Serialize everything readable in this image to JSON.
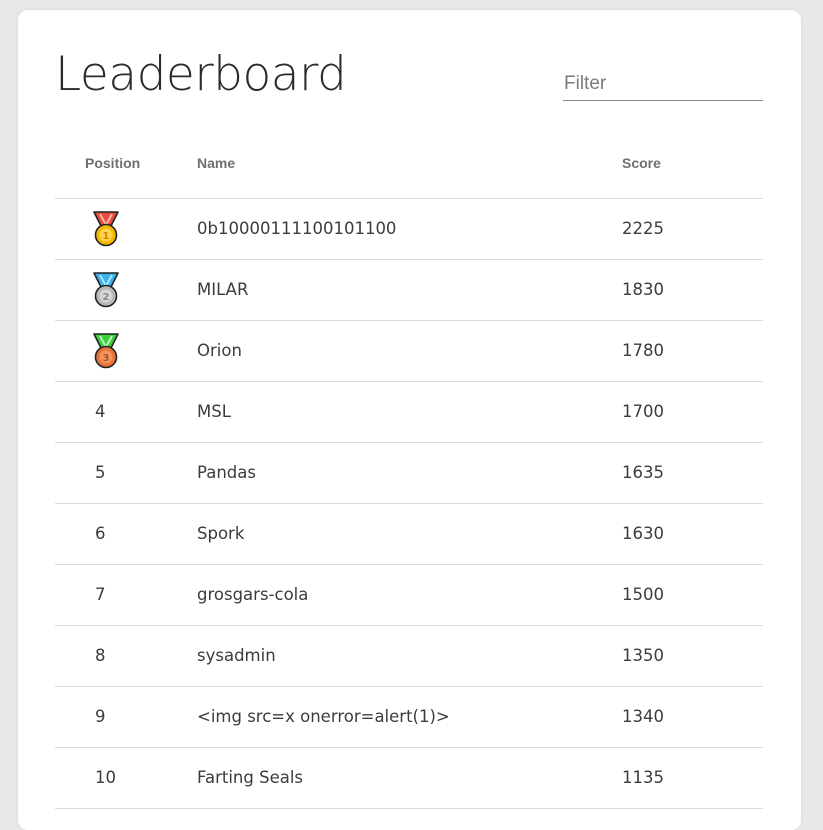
{
  "page": {
    "title": "Leaderboard",
    "filter_placeholder": "Filter"
  },
  "table": {
    "headers": {
      "position": "Position",
      "name": "Name",
      "score": "Score"
    },
    "rows": [
      {
        "position": "1",
        "medal": "gold-medal-icon",
        "name": "0b10000111100101100",
        "score": "2225"
      },
      {
        "position": "2",
        "medal": "silver-medal-icon",
        "name": "MILAR",
        "score": "1830"
      },
      {
        "position": "3",
        "medal": "bronze-medal-icon",
        "name": "Orion",
        "score": "1780"
      },
      {
        "position": "4",
        "name": "MSL",
        "score": "1700"
      },
      {
        "position": "5",
        "name": "Pandas",
        "score": "1635"
      },
      {
        "position": "6",
        "name": "Spork",
        "score": "1630"
      },
      {
        "position": "7",
        "name": "grosgars-cola",
        "score": "1500"
      },
      {
        "position": "8",
        "name": "sysadmin",
        "score": "1350"
      },
      {
        "position": "9",
        "name": "<img src=x onerror=alert(1)>",
        "score": "1340"
      },
      {
        "position": "10",
        "name": "Farting Seals",
        "score": "1135"
      }
    ]
  },
  "colors": {
    "background": "#e8e8e8",
    "card": "#ffffff",
    "text": "#3c3c3c",
    "header_text": "#6f6f6f",
    "divider": "#dcdcdc",
    "gold_ribbon": "#e74c3c",
    "gold_medal": "#f5b800",
    "silver_ribbon": "#3bb3e8",
    "silver_medal": "#b8b8b8",
    "bronze_ribbon": "#3ccf3c",
    "bronze_medal": "#e8733a"
  }
}
